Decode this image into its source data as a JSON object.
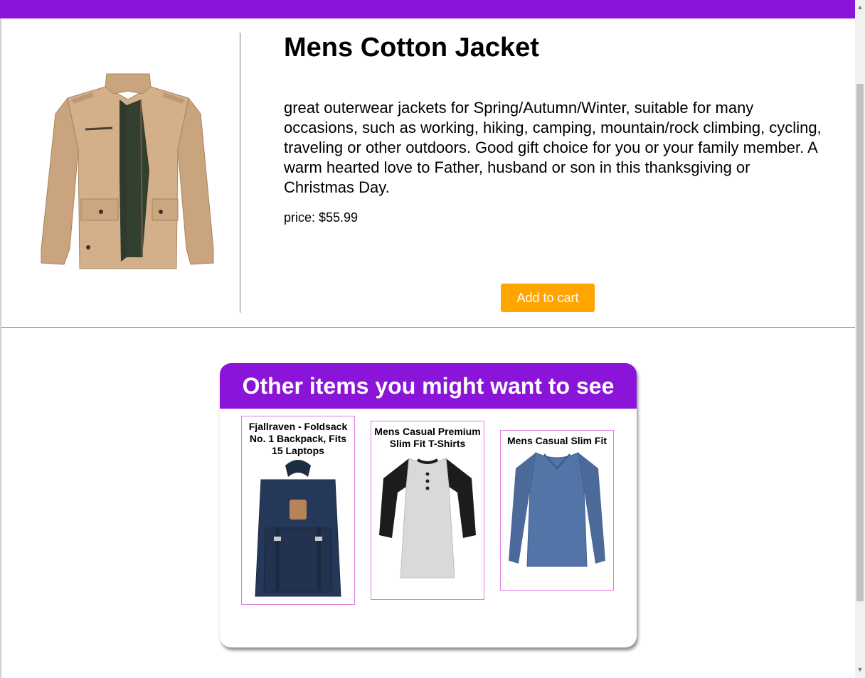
{
  "product": {
    "title": "Mens Cotton Jacket",
    "description": "great outerwear jackets for Spring/Autumn/Winter, suitable for many occasions, such as working, hiking, camping, mountain/rock climbing, cycling, traveling or other outdoors. Good gift choice for you or your family member. A warm hearted love to Father, husband or son in this thanksgiving or Christmas Day.",
    "price": "price: $55.99",
    "add_to_cart_label": "Add to cart",
    "image_icon": "jacket-image"
  },
  "recommendations": {
    "heading": "Other items you might want to see",
    "items": [
      {
        "title": "Fjallraven - Foldsack No. 1 Backpack, Fits 15 Laptops",
        "icon": "backpack-image"
      },
      {
        "title": "Mens Casual Premium Slim Fit T-Shirts",
        "icon": "raglan-tshirt-image"
      },
      {
        "title": "Mens Casual Slim Fit",
        "icon": "long-sleeve-shirt-image"
      }
    ]
  },
  "colors": {
    "brand_purple": "#8a14d8",
    "cart_button": "#ffa500",
    "card_border": "#e07ce0"
  }
}
